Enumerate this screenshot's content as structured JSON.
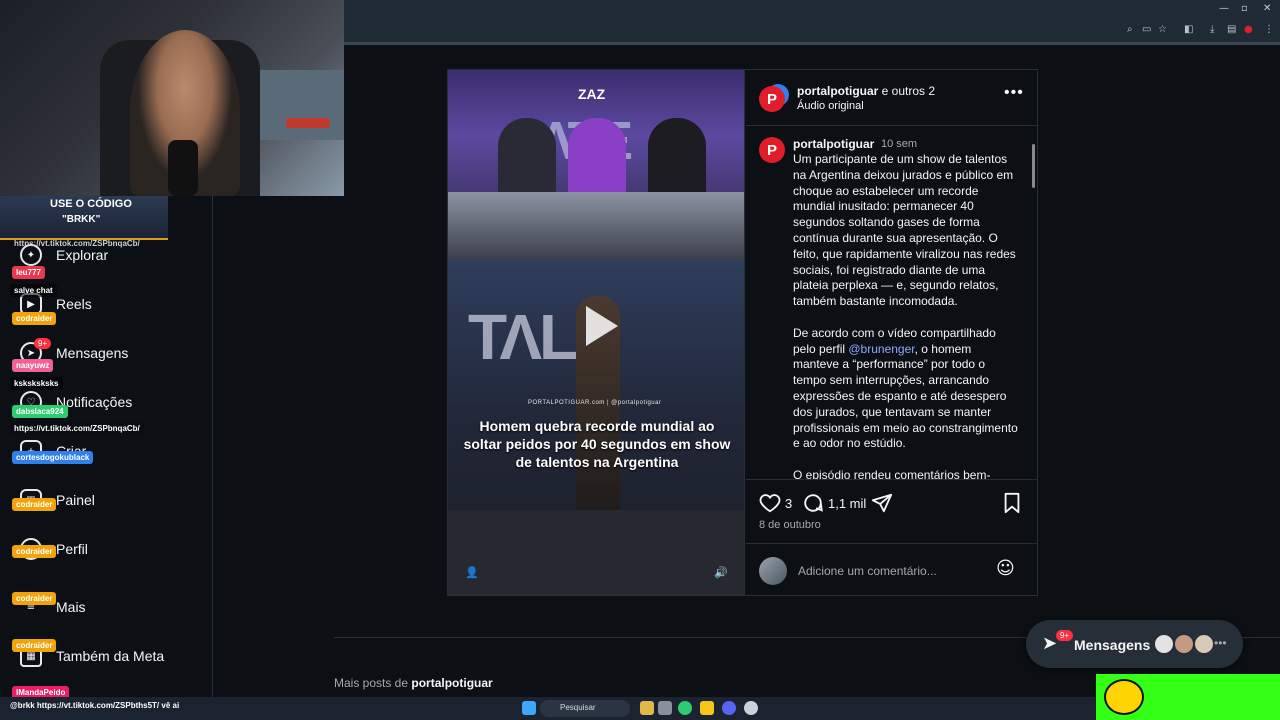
{
  "sidebar": {
    "items": [
      {
        "label": "Explorar",
        "icon": "compass-icon"
      },
      {
        "label": "Reels",
        "icon": "reels-icon"
      },
      {
        "label": "Mensagens",
        "icon": "messenger-icon",
        "badge": "9+"
      },
      {
        "label": "Notificações",
        "icon": "heart-icon"
      },
      {
        "label": "Criar",
        "icon": "plus-icon"
      },
      {
        "label": "Painel",
        "icon": "dashboard-icon"
      },
      {
        "label": "Perfil",
        "icon": "profile-icon"
      },
      {
        "label": "Mais",
        "icon": "menu-icon"
      },
      {
        "label": "Também da Meta",
        "icon": "meta-icon"
      }
    ]
  },
  "overlay": {
    "promo_line1": "USE O CÓDIGO",
    "promo_line2": "\"BRKK\"",
    "promo_url": "https://vt.tiktok.com/ZSPbnqaCb/",
    "chat": [
      {
        "user": "leu777",
        "text": "salve chat",
        "color": "#e8384f"
      },
      {
        "user": "codraider",
        "text": "",
        "color": "#f0a30a"
      },
      {
        "user": "naayuwz",
        "text": "ksksksksks",
        "color": "#f06292"
      },
      {
        "user": "dabslaca924",
        "text": "https://vt.tiktok.com/ZSPbnqaCb/",
        "color": "#2ecc71"
      },
      {
        "user": "cortesdogokublack",
        "text": "",
        "color": "#2f80ed"
      },
      {
        "user": "codraider",
        "text": "",
        "color": "#f0a30a"
      },
      {
        "user": "codraider",
        "text": "",
        "color": "#f0a30a"
      },
      {
        "user": "codraider",
        "text": "",
        "color": "#f0a30a"
      },
      {
        "user": "codraider",
        "text": "",
        "color": "#f0a30a"
      },
      {
        "user": "lMandaPeido",
        "text": "@brkk https://vt.tiktok.com/ZSPbths5T/ vê ai",
        "color": "#e91e63"
      }
    ]
  },
  "video": {
    "watermark": "ZAZ",
    "brand_strip": "PORTALPOTIGUAR.com | @portalpotiguar",
    "caption": "Homem quebra recorde mundial ao soltar peidos por 40 segundos em show de talentos na Argentina"
  },
  "post": {
    "author": "portalpotiguar",
    "coauthors": " e outros 2",
    "audio": "Áudio original",
    "comment_user": "portalpotiguar",
    "comment_time": "10 sem",
    "paragraph1": "Um participante de um show de talentos na Argentina deixou jurados e público em choque ao estabelecer um recorde mundial inusitado: permanecer 40 segundos soltando gases de forma contínua durante sua apresentação. O feito, que rapidamente viralizou nas redes sociais, foi registrado diante de uma plateia perplexa — e, segundo relatos, também bastante incomodada.",
    "paragraph2_a": "De acordo com o vídeo compartilhado pelo perfil ",
    "paragraph2_mention": "@brunenger",
    "paragraph2_b": ", o homem manteve a “performance” por todo o tempo sem interrupções, arrancando expressões de espanto e até desespero dos jurados, que tentavam se manter profissionais em meio ao constrangimento e ao odor no estúdio.",
    "paragraph3": "O episódio rendeu comentários bem-",
    "likes": "3",
    "comments": "1,1 mil",
    "date": "8 de outubro",
    "add_comment_placeholder": "Adicione um comentário..."
  },
  "more_posts": {
    "prefix": "Mais posts de ",
    "user": "portalpotiguar"
  },
  "messages_pill": {
    "label": "Mensagens",
    "badge": "9+"
  },
  "taskbar": {
    "search": "Pesquisar"
  }
}
